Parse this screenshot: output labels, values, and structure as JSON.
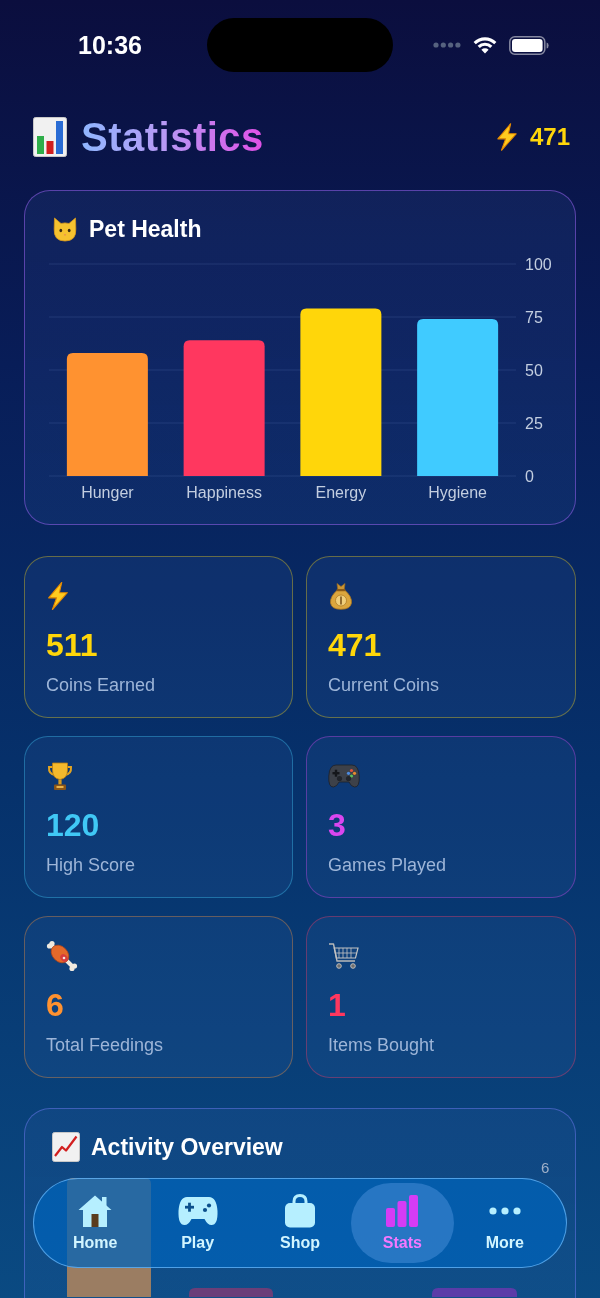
{
  "status_bar": {
    "time": "10:36"
  },
  "header": {
    "title": "Statistics",
    "coins": "471"
  },
  "pet_health": {
    "title": "Pet Health",
    "chart_data": {
      "type": "bar",
      "categories": [
        "Hunger",
        "Happiness",
        "Energy",
        "Hygiene"
      ],
      "series": [
        {
          "color": "#ff9230",
          "values": [
            58,
            null,
            null,
            null
          ]
        },
        {
          "color": "#ff375f",
          "values": [
            null,
            64,
            null,
            null
          ]
        },
        {
          "color": "#ffd60a",
          "values": [
            null,
            null,
            79,
            null
          ]
        },
        {
          "color": "#40cbff",
          "values": [
            null,
            null,
            null,
            74
          ]
        }
      ],
      "stacked": true,
      "grid": true,
      "ylim": [
        0,
        100
      ],
      "yticks": [
        0,
        25,
        50,
        75,
        100
      ]
    }
  },
  "stats": [
    {
      "value": "511",
      "label": "Coins Earned",
      "color": "#ffd60a"
    },
    {
      "value": "471",
      "label": "Current Coins",
      "color": "#ffd60a"
    },
    {
      "value": "120",
      "label": "High Score",
      "color": "#40c8f5"
    },
    {
      "value": "3",
      "label": "Games Played",
      "color": "#d946ef"
    },
    {
      "value": "6",
      "label": "Total Feedings",
      "color": "#ff9230"
    },
    {
      "value": "1",
      "label": "Items Bought",
      "color": "#ff375f"
    }
  ],
  "activity_overview": {
    "title": "Activity Overview",
    "y_tick": "6"
  },
  "tab_bar": [
    {
      "label": "Home",
      "selected": false
    },
    {
      "label": "Play",
      "selected": false
    },
    {
      "label": "Shop",
      "selected": false
    },
    {
      "label": "Stats",
      "selected": true
    },
    {
      "label": "More",
      "selected": false
    }
  ]
}
